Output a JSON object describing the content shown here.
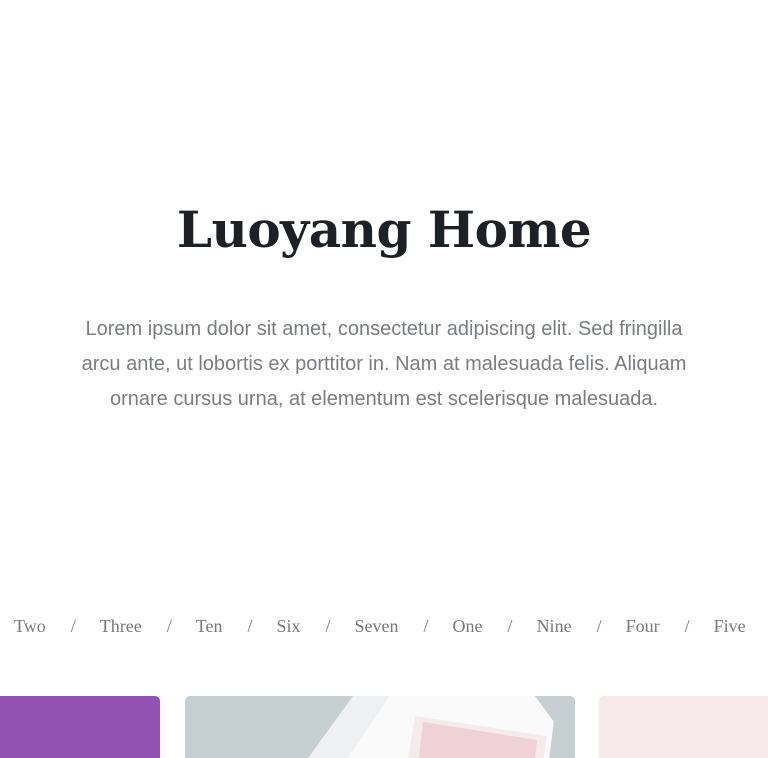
{
  "hero": {
    "title": "Luoyang Home",
    "description": "Lorem ipsum dolor sit amet, consectetur adipiscing elit. Sed fringilla arcu ante, ut lobortis ex porttitor in. Nam at malesuada felis. Aliquam ornare cursus urna, at elementum est scelerisque malesuada."
  },
  "filters": {
    "items": [
      "Two",
      "Three",
      "Ten",
      "Six",
      "Seven",
      "One",
      "Nine",
      "Four",
      "Five"
    ],
    "separator": "/"
  },
  "cards": [
    {
      "color": "#9252b3"
    },
    {
      "color": "#c6d0d2"
    },
    {
      "color": "#f7e9ea"
    }
  ]
}
